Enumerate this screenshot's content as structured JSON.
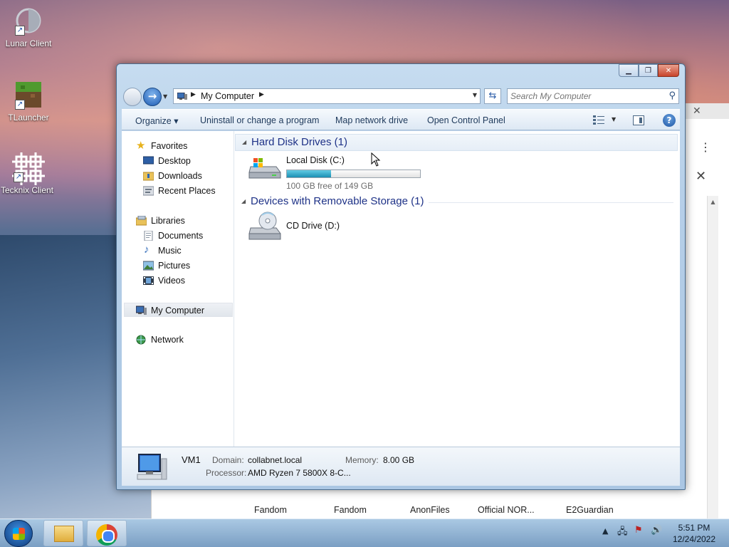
{
  "desktop": {
    "icons": [
      {
        "label": "Lunar Client"
      },
      {
        "label": "TLauncher"
      },
      {
        "label": "Tecknix Client"
      }
    ]
  },
  "background_browser": {
    "bookmarks": [
      "Fandom",
      "Fandom",
      "AnonFiles",
      "Official NOR...",
      "E2Guardian"
    ]
  },
  "explorer": {
    "address": {
      "path": "My Computer"
    },
    "search": {
      "placeholder": "Search My Computer"
    },
    "commands": {
      "organize": "Organize",
      "uninstall": "Uninstall or change a program",
      "map_drive": "Map network drive",
      "control_panel": "Open Control Panel"
    },
    "nav": {
      "favorites": "Favorites",
      "desktop": "Desktop",
      "downloads": "Downloads",
      "recent": "Recent Places",
      "libraries": "Libraries",
      "documents": "Documents",
      "music": "Music",
      "pictures": "Pictures",
      "videos": "Videos",
      "my_computer": "My Computer",
      "network": "Network"
    },
    "groups": {
      "hdd_header": "Hard Disk Drives (1)",
      "removable_header": "Devices with Removable Storage (1)"
    },
    "drives": {
      "c": {
        "name": "Local Disk (C:)",
        "free_text": "100 GB free of 149 GB",
        "used_fraction": 0.33
      },
      "d": {
        "name": "CD Drive (D:)"
      }
    },
    "details": {
      "computer_name": "VM1",
      "domain_label": "Domain:",
      "domain_value": "collabnet.local",
      "memory_label": "Memory:",
      "memory_value": "8.00 GB",
      "processor_label": "Processor:",
      "processor_value": "AMD Ryzen 7 5800X 8-C..."
    }
  },
  "taskbar": {
    "time": "5:51 PM",
    "date": "12/24/2022"
  },
  "colors": {
    "group_header": "#1e3287",
    "drive_bar_fill": "#1b8fb3",
    "close_button": "#c8442b"
  }
}
